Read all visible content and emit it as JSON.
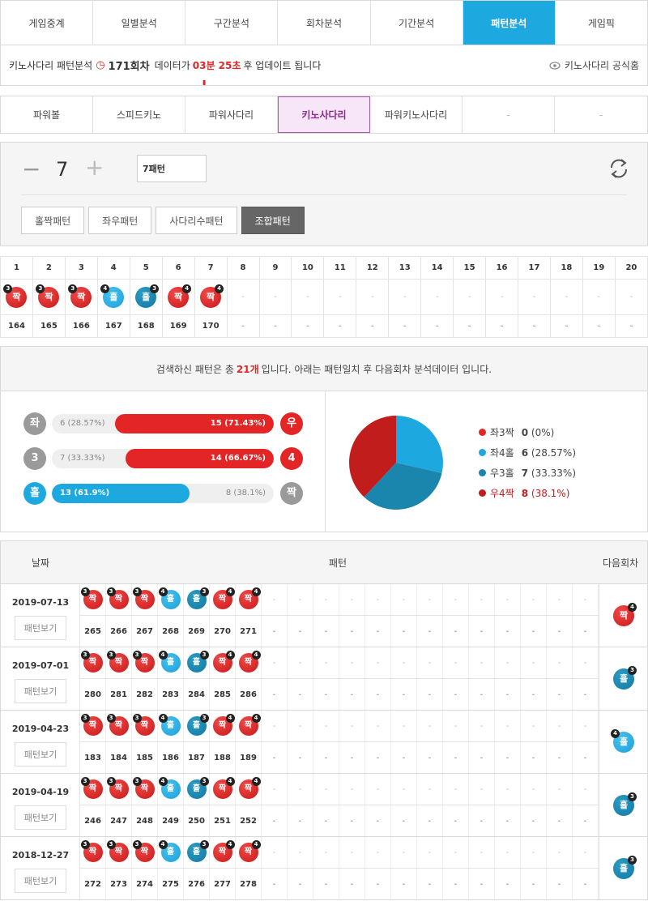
{
  "main_nav": [
    "게임중계",
    "일별분석",
    "구간분석",
    "회차분석",
    "기간분석",
    "패턴분석",
    "게임픽"
  ],
  "info_bar": {
    "prefix": "키노사다리 패턴분석",
    "round": "171회차",
    "middle": "데이터가",
    "timer": "03분 25초",
    "suffix": "후 업데이트 됩니다",
    "official": "키노사다리 공식홈"
  },
  "sub_nav": [
    "파워볼",
    "스피드키노",
    "파워사다리",
    "키노사다리",
    "파워키노사다리",
    "-",
    "-"
  ],
  "control": {
    "minus": "−",
    "count": "7",
    "plus": "+",
    "pattern_value": "7패턴",
    "buttons": [
      "홀짝패턴",
      "좌우패턴",
      "사다리수패턴",
      "조합패턴"
    ]
  },
  "pattern_table": {
    "headers": [
      "1",
      "2",
      "3",
      "4",
      "5",
      "6",
      "7",
      "8",
      "9",
      "10",
      "11",
      "12",
      "13",
      "14",
      "15",
      "16",
      "17",
      "18",
      "19",
      "20"
    ],
    "balls": [
      {
        "t": "짝",
        "c": "red",
        "s": "3",
        "p": "l"
      },
      {
        "t": "짝",
        "c": "red",
        "s": "3",
        "p": "l"
      },
      {
        "t": "짝",
        "c": "red",
        "s": "3",
        "p": "l"
      },
      {
        "t": "홀",
        "c": "blue",
        "s": "4",
        "p": "l"
      },
      {
        "t": "홀",
        "c": "teal",
        "s": "3",
        "p": "r"
      },
      {
        "t": "짝",
        "c": "red",
        "s": "4",
        "p": "r"
      },
      {
        "t": "짝",
        "c": "red",
        "s": "4",
        "p": "r"
      }
    ],
    "rounds": [
      "164",
      "165",
      "166",
      "167",
      "168",
      "169",
      "170"
    ],
    "dash": "-"
  },
  "summary": {
    "before": "검색하신 패턴은 총",
    "count": "21개",
    "after": "입니다. 아래는 패턴일치 후 다음회차 분석데이터 입니다."
  },
  "bars": [
    {
      "left": "좌",
      "right": "우",
      "left_text": "6 (28.57%)",
      "right_text": "15 (71.43%)",
      "left_pct": 28.57,
      "right_pct": 71.43
    },
    {
      "left": "3",
      "right": "4",
      "left_text": "7 (33.33%)",
      "right_text": "14 (66.67%)",
      "left_pct": 33.33,
      "right_pct": 66.67
    },
    {
      "left": "홀",
      "right": "짝",
      "left_text": "13 (61.9%)",
      "right_text": "8 (38.1%)",
      "left_pct": 61.9,
      "right_pct": 38.1
    }
  ],
  "chart_data": {
    "type": "pie",
    "categories": [
      "좌3짝",
      "좌4홀",
      "우3홀",
      "우4짝"
    ],
    "values": [
      0,
      6,
      7,
      8
    ],
    "labels": [
      "0 (0%)",
      "6 (28.57%)",
      "7 (33.33%)",
      "8 (38.1%)"
    ],
    "colors": [
      "#e42526",
      "#1ea8e0",
      "#1a86ad",
      "#c21d1d"
    ],
    "legend": "right"
  },
  "history_header": {
    "date": "날짜",
    "pattern": "패턴",
    "next": "다음회차"
  },
  "history": [
    {
      "date": "2019-07-13",
      "view": "패턴보기",
      "rounds": [
        "265",
        "266",
        "267",
        "268",
        "269",
        "270",
        "271"
      ],
      "next": {
        "t": "짝",
        "c": "red",
        "s": "4",
        "p": "r"
      }
    },
    {
      "date": "2019-07-01",
      "view": "패턴보기",
      "rounds": [
        "280",
        "281",
        "282",
        "283",
        "284",
        "285",
        "286"
      ],
      "next": {
        "t": "홀",
        "c": "teal",
        "s": "3",
        "p": "r"
      }
    },
    {
      "date": "2019-04-23",
      "view": "패턴보기",
      "rounds": [
        "183",
        "184",
        "185",
        "186",
        "187",
        "188",
        "189"
      ],
      "next": {
        "t": "홀",
        "c": "blue",
        "s": "4",
        "p": "l"
      }
    },
    {
      "date": "2019-04-19",
      "view": "패턴보기",
      "rounds": [
        "246",
        "247",
        "248",
        "249",
        "250",
        "251",
        "252"
      ],
      "next": {
        "t": "홀",
        "c": "teal",
        "s": "3",
        "p": "r"
      }
    },
    {
      "date": "2018-12-27",
      "view": "패턴보기",
      "rounds": [
        "272",
        "273",
        "274",
        "275",
        "276",
        "277",
        "278"
      ],
      "next": {
        "t": "홀",
        "c": "teal",
        "s": "3",
        "p": "r"
      }
    }
  ]
}
